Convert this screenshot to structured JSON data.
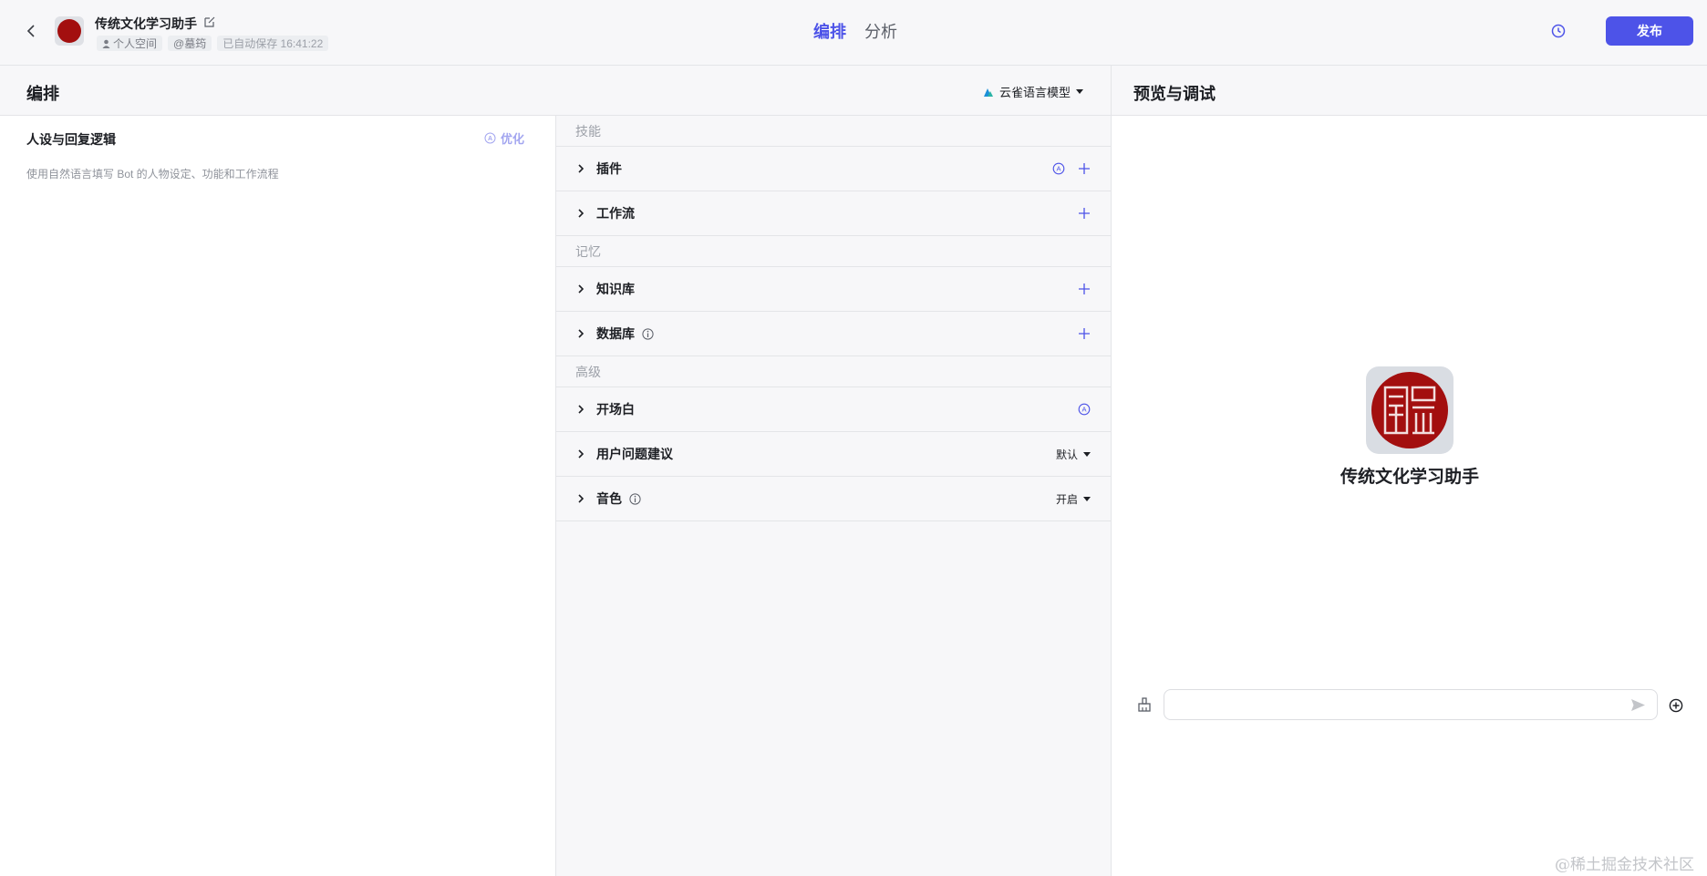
{
  "header": {
    "bot_name": "传统文化学习助手",
    "space": "个人空间",
    "owner": "@墓筠",
    "autosave": "已自动保存 16:41:22",
    "tabs": [
      "编排",
      "分析"
    ],
    "active_tab": "编排",
    "publish_label": "发布",
    "accent_color": "#4d53e8"
  },
  "editor": {
    "title": "编排",
    "model": "云雀语言模型",
    "persona": {
      "title": "人设与回复逻辑",
      "optimize_label": "优化",
      "placeholder": "使用自然语言填写 Bot 的人物设定、功能和工作流程"
    }
  },
  "skills": {
    "groups": [
      {
        "label": "技能",
        "rows": [
          {
            "label": "插件",
            "auto": true,
            "plus": true
          },
          {
            "label": "工作流",
            "plus": true
          }
        ]
      },
      {
        "label": "记忆",
        "rows": [
          {
            "label": "知识库",
            "plus": true
          },
          {
            "label": "数据库",
            "info": true,
            "plus": true
          }
        ]
      },
      {
        "label": "高级",
        "rows": [
          {
            "label": "开场白",
            "auto": true
          },
          {
            "label": "用户问题建议",
            "dropdown": "默认"
          },
          {
            "label": "音色",
            "info": true,
            "dropdown": "开启"
          }
        ]
      }
    ]
  },
  "preview": {
    "title": "预览与调试",
    "bot_name": "传统文化学习助手",
    "input_placeholder": ""
  },
  "watermark": "@稀土掘金技术社区"
}
